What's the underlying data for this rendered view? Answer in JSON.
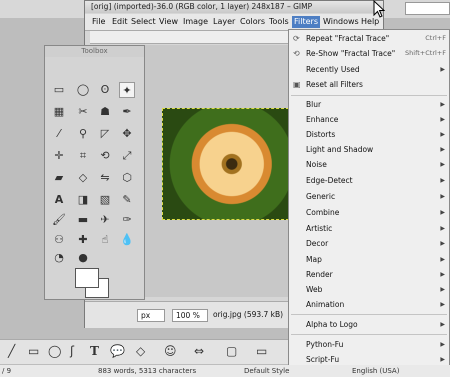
{
  "window": {
    "title": "[orig] (imported)-36.0 (RGB color, 1 layer) 248x187 – GIMP"
  },
  "menubar": {
    "items": [
      "File",
      "Edit",
      "Select",
      "View",
      "Image",
      "Layer",
      "Colors",
      "Tools",
      "Filters",
      "Windows",
      "Help"
    ],
    "active": "Filters"
  },
  "toolbox": {
    "title": "Toolbox"
  },
  "statusbar": {
    "unit": "px",
    "zoom": "100 %",
    "file": "orig.jpg (593.7 kB)"
  },
  "filters_menu": {
    "top_items": [
      {
        "label": "Repeat \"Fractal Trace\"",
        "shortcut": "Ctrl+F",
        "icon": "repeat-icon"
      },
      {
        "label": "Re-Show \"Fractal Trace\"",
        "shortcut": "Shift+Ctrl+F",
        "icon": "reshow-icon"
      },
      {
        "label": "Recently Used",
        "submenu": true
      },
      {
        "label": "Reset all Filters",
        "icon": "reset-icon"
      }
    ],
    "groups": [
      "Blur",
      "Enhance",
      "Distorts",
      "Light and Shadow",
      "Noise",
      "Edge-Detect",
      "Generic",
      "Combine",
      "Artistic",
      "Decor",
      "Map",
      "Render",
      "Web",
      "Animation"
    ],
    "alpha": "Alpha to Logo",
    "scripts": [
      "Python-Fu",
      "Script-Fu"
    ]
  },
  "footer": {
    "page": "/ 9",
    "words": "883 words, 5313 characters",
    "style": "Default Style",
    "lang": "English (USA)"
  },
  "colors": {
    "accent": "#4d7ec3",
    "menu_bg": "#efefef"
  }
}
